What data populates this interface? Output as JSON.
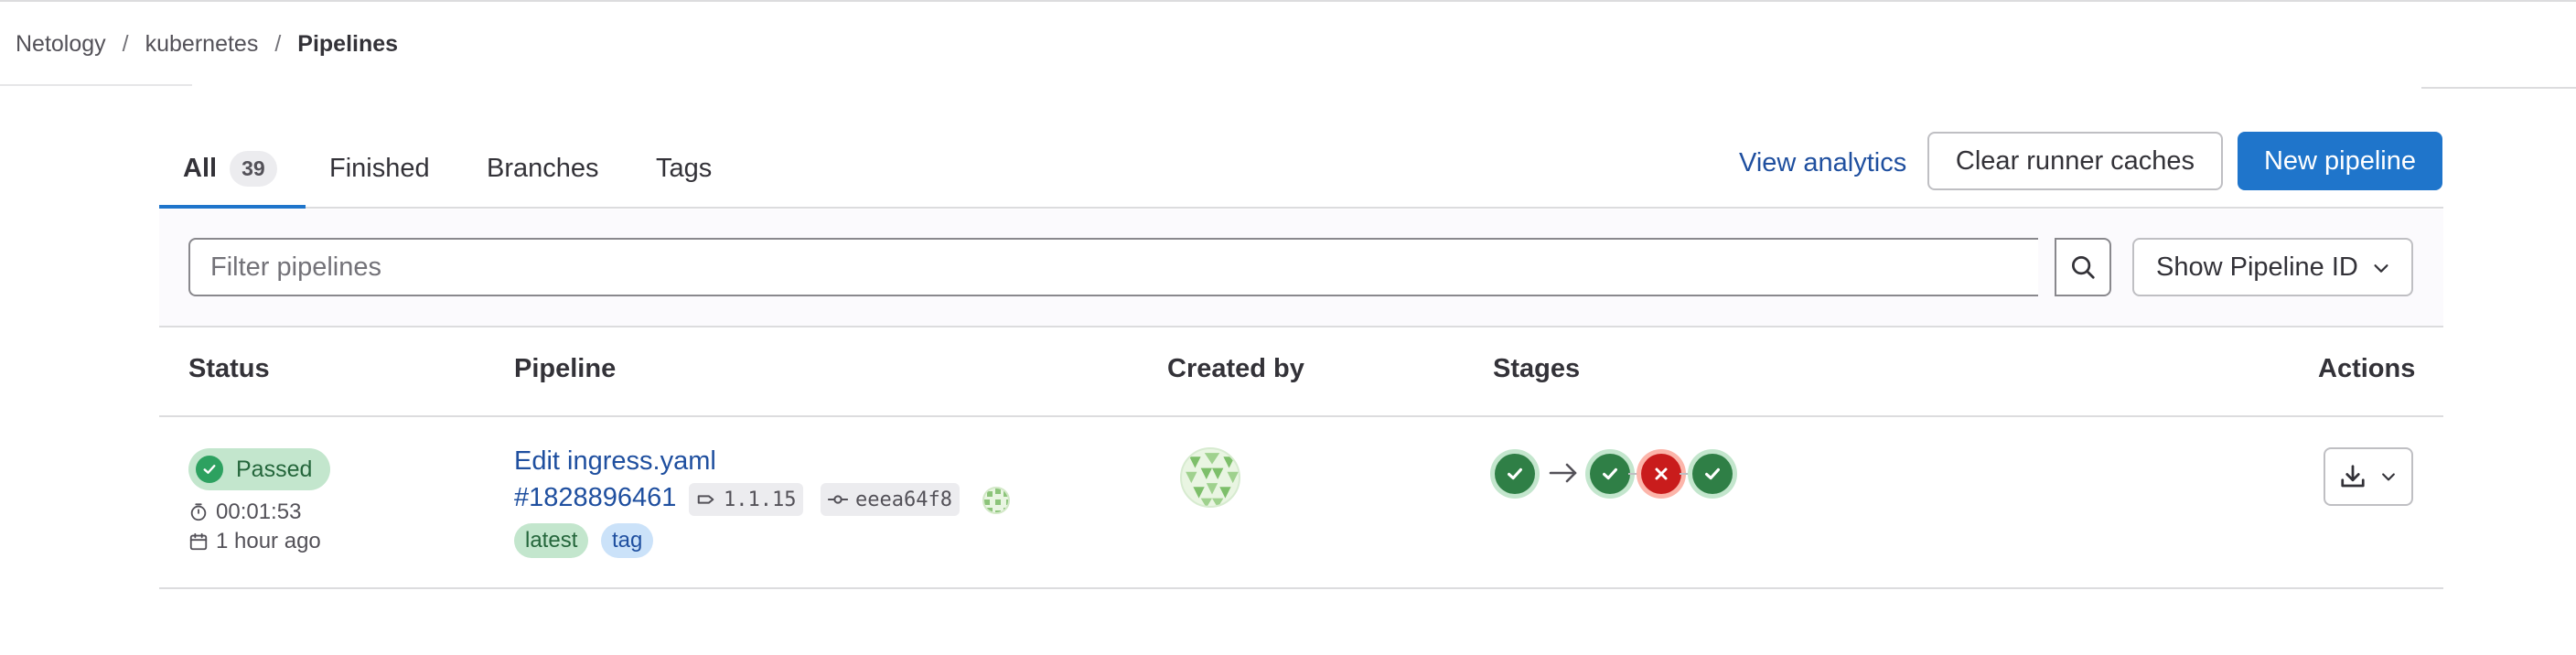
{
  "breadcrumb": {
    "items": [
      "Netology",
      "kubernetes"
    ],
    "separator": "/",
    "current": "Pipelines"
  },
  "tabs": [
    {
      "label": "All",
      "count": "39",
      "active": true
    },
    {
      "label": "Finished"
    },
    {
      "label": "Branches"
    },
    {
      "label": "Tags"
    }
  ],
  "actions": {
    "view_analytics": "View analytics",
    "clear_caches": "Clear runner caches",
    "new_pipeline": "New pipeline"
  },
  "filter": {
    "placeholder": "Filter pipelines",
    "show_id_label": "Show Pipeline ID"
  },
  "table": {
    "headers": {
      "status": "Status",
      "pipeline": "Pipeline",
      "created_by": "Created by",
      "stages": "Stages",
      "actions": "Actions"
    },
    "rows": [
      {
        "status": "Passed",
        "duration": "00:01:53",
        "finished": "1 hour ago",
        "title": "Edit ingress.yaml",
        "id": "#1828896461",
        "ref": "1.1.15",
        "commit": "eeea64f8",
        "labels": [
          "latest",
          "tag"
        ],
        "stages": [
          "success",
          "success",
          "failed",
          "success"
        ]
      }
    ]
  },
  "colors": {
    "primary": "#1f75cb",
    "link": "#1f4f9f",
    "success": "#2f7f46",
    "danger": "#c91c1c"
  },
  "icons": [
    "search-icon",
    "chevron-down-icon",
    "timer-icon",
    "calendar-icon",
    "branch-tag-icon",
    "commit-icon",
    "check-circle-icon",
    "close-icon",
    "arrow-right-icon",
    "download-icon"
  ]
}
